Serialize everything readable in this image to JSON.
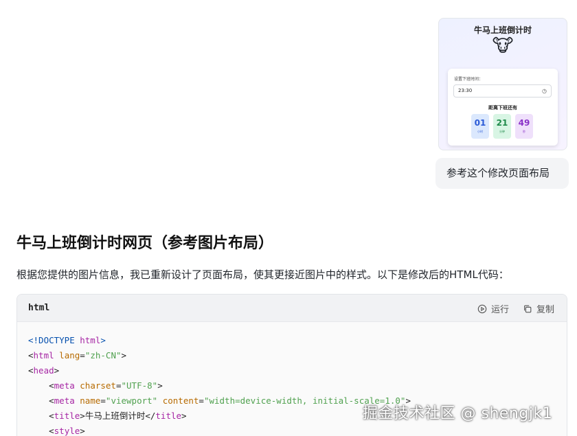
{
  "attachment": {
    "title": "牛马上班倒计时",
    "emoji": "🐮",
    "input_label": "设置下班时间：",
    "input_value": "23:30",
    "subtitle": "距离下班还有",
    "countdown": [
      {
        "value": "01",
        "unit": "小时",
        "color": "#2b5bd7"
      },
      {
        "value": "21",
        "unit": "分钟",
        "color": "#1f8a4a"
      },
      {
        "value": "49",
        "unit": "秒",
        "color": "#8a33c8"
      }
    ]
  },
  "user_message": "参考这个修改页面布局",
  "response": {
    "title": "牛马上班倒计时网页（参考图片布局）",
    "intro": "根据您提供的图片信息，我已重新设计了页面布局，使其更接近图片中的样式。以下是修改后的HTML代码：",
    "code_block": {
      "language": "html",
      "run_label": "运行",
      "copy_label": "复制",
      "lines": {
        "l1_doctype": "<!DOCTYPE",
        "l1_html": " html",
        "l1_close": ">",
        "l2_open": "<",
        "l2_tag": "html",
        "l2_attr": " lang",
        "l2_eq": "=",
        "l2_val": "\"zh-CN\"",
        "l2_close": ">",
        "l3_open": "<",
        "l3_tag": "head",
        "l3_close": ">",
        "l4_open": "<",
        "l4_tag": "meta",
        "l4_attr": " charset",
        "l4_eq": "=",
        "l4_val": "\"UTF-8\"",
        "l4_close": ">",
        "l5_open": "<",
        "l5_tag": "meta",
        "l5_attr1": " name",
        "l5_eq1": "=",
        "l5_val1": "\"viewport\"",
        "l5_attr2": " content",
        "l5_eq2": "=",
        "l5_val2": "\"width=device-width, initial-scale=1.0\"",
        "l5_close": ">",
        "l6_open": "<",
        "l6_tag": "title",
        "l6_gt": ">",
        "l6_text": "牛马上班倒计时",
        "l6_close_open": "</",
        "l6_close_tag": "title",
        "l6_close": ">",
        "l7_open": "<",
        "l7_tag": "style",
        "l7_close": ">"
      }
    }
  },
  "watermark": "掘金技术社区 @ shengjk1"
}
